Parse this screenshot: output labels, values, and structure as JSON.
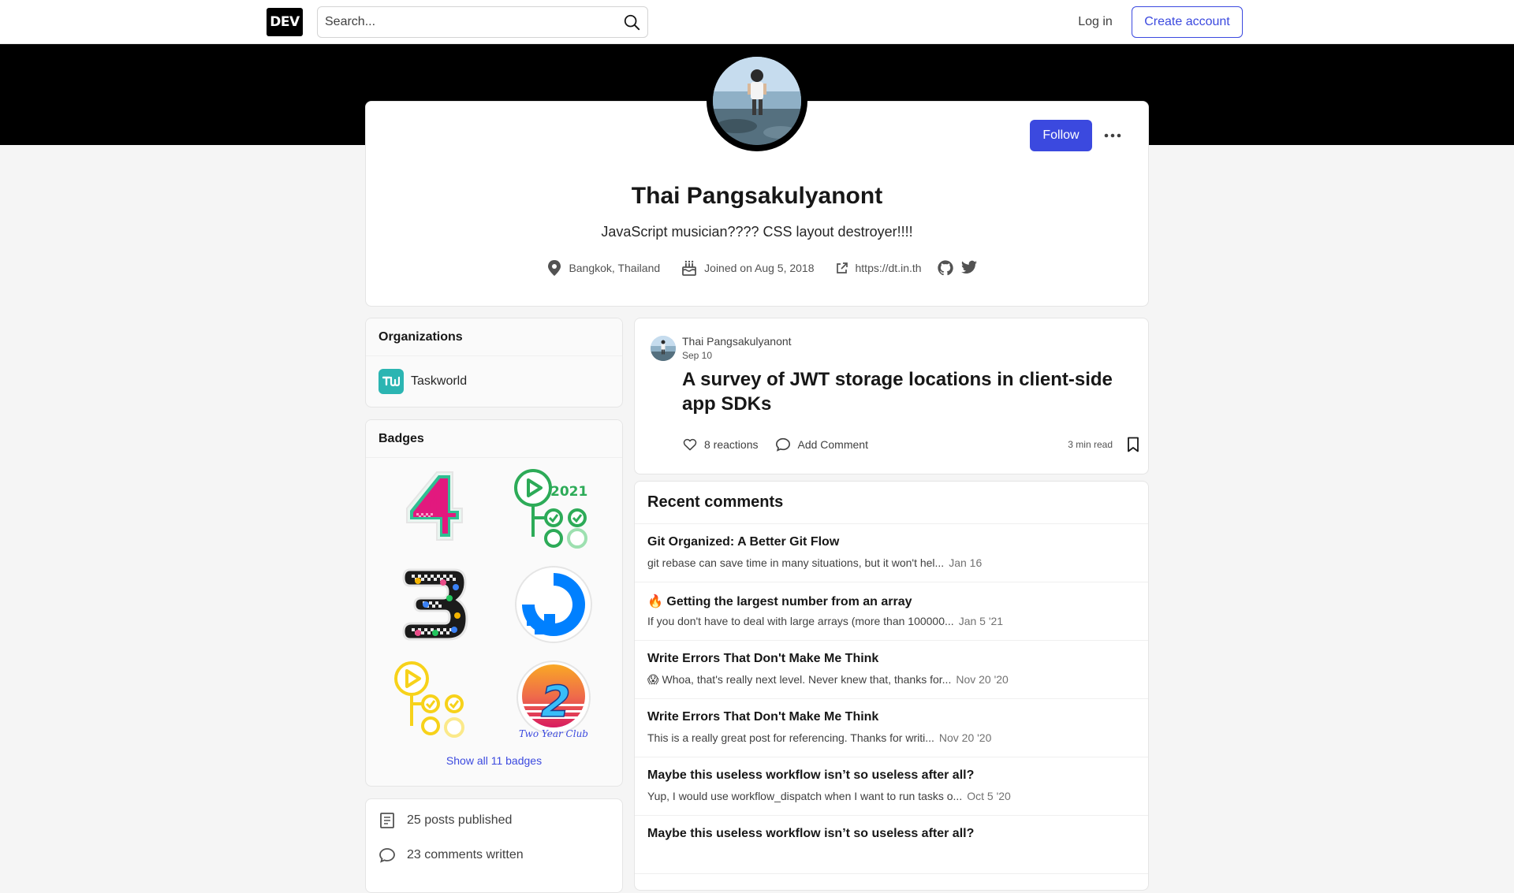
{
  "header": {
    "logo": "DEV",
    "search_placeholder": "Search...",
    "login_label": "Log in",
    "create_account_label": "Create account"
  },
  "profile": {
    "name": "Thai Pangsakulyanont",
    "bio": "JavaScript musician???? CSS layout destroyer!!!!",
    "location": "Bangkok, Thailand",
    "joined": "Joined on Aug 5, 2018",
    "website": "https://dt.in.th",
    "follow_label": "Follow",
    "social_icons": [
      "github-icon",
      "twitter-icon"
    ]
  },
  "sidebar": {
    "organizations_title": "Organizations",
    "organizations": [
      {
        "name": "Taskworld",
        "logo_text": "ᴛᴡ"
      }
    ],
    "badges_title": "Badges",
    "badges": [
      {
        "name": "four-year-club-badge",
        "label": "4"
      },
      {
        "name": "github-actions-2021-badge",
        "label": "2021"
      },
      {
        "name": "three-year-club-badge",
        "label": "3"
      },
      {
        "name": "digitalocean-badge",
        "label": ""
      },
      {
        "name": "github-actions-badge",
        "label": ""
      },
      {
        "name": "two-year-club-badge",
        "label": "2",
        "caption": "Two Year Club"
      }
    ],
    "show_all_badges_label": "Show all 11 badges",
    "stats": [
      {
        "icon": "post-icon",
        "label": "25 posts published"
      },
      {
        "icon": "comment-icon",
        "label": "23 comments written"
      }
    ]
  },
  "post": {
    "author": "Thai Pangsakulyanont",
    "date": "Sep 10",
    "title": "A survey of JWT storage locations in client-side app SDKs",
    "reactions": "8 reactions",
    "add_comment": "Add Comment",
    "read_time": "3 min read"
  },
  "recent_comments": {
    "title": "Recent comments",
    "items": [
      {
        "title": "Git Organized: A Better Git Flow",
        "body": "git rebase can save time in many situations, but it won't hel...",
        "date": "Jan 16"
      },
      {
        "title": "🔥 Getting the largest number from an array",
        "body": "If you don't have to deal with large arrays (more than 100000...",
        "date": "Jan 5 '21"
      },
      {
        "title": "Write Errors That Don't Make Me Think",
        "body": "😱 Whoa, that's really next level. Never knew that, thanks for...",
        "date": "Nov 20 '20"
      },
      {
        "title": "Write Errors That Don't Make Me Think",
        "body": "This is a really great post for referencing. Thanks for writi...",
        "date": "Nov 20 '20"
      },
      {
        "title": "Maybe this useless workflow isn’t so useless after all?",
        "body": "Yup, I would use workflow_dispatch when I want to run tasks o...",
        "date": "Oct 5 '20"
      },
      {
        "title": "Maybe this useless workflow isn’t so useless after all?",
        "body": "",
        "date": ""
      }
    ]
  },
  "colors": {
    "accent": "#3b49df",
    "banner": "#000000",
    "background": "#f5f5f5"
  }
}
